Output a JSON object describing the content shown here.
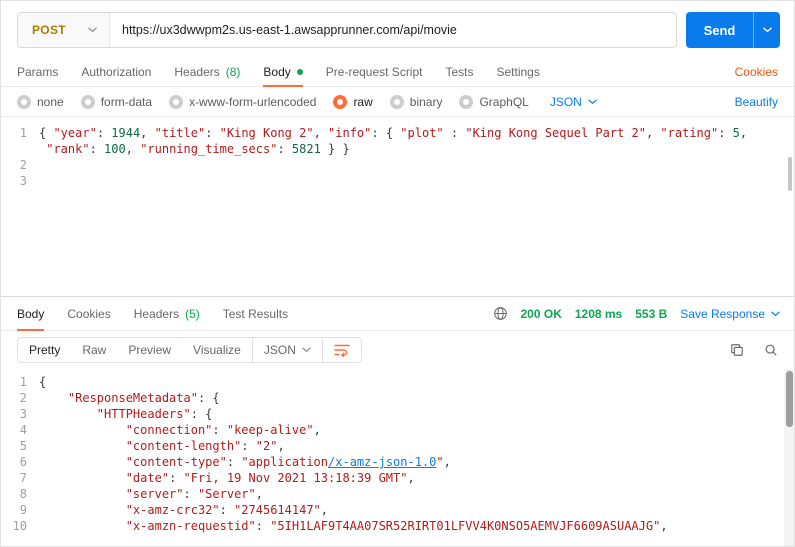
{
  "colors": {
    "accent_orange": "#ff6c37",
    "link_blue": "#097bed",
    "status_green": "#0ca750",
    "method_post_amber": "#ad7a03",
    "cookies_link_orange": "#e8590c",
    "code_string_red": "#b11b1b",
    "code_number_green": "#116644"
  },
  "request": {
    "method": "POST",
    "url": "https://ux3dwwpm2s.us-east-1.awsapprunner.com/api/movie",
    "send_label": "Send",
    "tabs": [
      {
        "label": "Params"
      },
      {
        "label": "Authorization"
      },
      {
        "label": "Headers",
        "count": "(8)"
      },
      {
        "label": "Body"
      },
      {
        "label": "Pre-request Script"
      },
      {
        "label": "Tests"
      },
      {
        "label": "Settings"
      }
    ],
    "cookies_link": "Cookies",
    "body_modes": [
      "none",
      "form-data",
      "x-www-form-urlencoded",
      "raw",
      "binary",
      "GraphQL"
    ],
    "selected_mode": "raw",
    "language": "JSON",
    "beautify_link": "Beautify",
    "code": [
      {
        "num": "1",
        "tokens": [
          {
            "t": "{ ",
            "c": "p"
          },
          {
            "t": "\"year\"",
            "c": "k"
          },
          {
            "t": ": ",
            "c": "p"
          },
          {
            "t": "1944",
            "c": "n"
          },
          {
            "t": ", ",
            "c": "p"
          },
          {
            "t": "\"title\"",
            "c": "k"
          },
          {
            "t": ": ",
            "c": "p"
          },
          {
            "t": "\"King Kong 2\"",
            "c": "s"
          },
          {
            "t": ", ",
            "c": "p"
          },
          {
            "t": "\"info\"",
            "c": "k"
          },
          {
            "t": ": { ",
            "c": "p"
          },
          {
            "t": "\"plot\"",
            "c": "k"
          },
          {
            "t": " : ",
            "c": "p"
          },
          {
            "t": "\"King Kong Sequel Part 2\"",
            "c": "s"
          },
          {
            "t": ", ",
            "c": "p"
          },
          {
            "t": "\"rating\"",
            "c": "k"
          },
          {
            "t": ": ",
            "c": "p"
          },
          {
            "t": "5",
            "c": "n"
          },
          {
            "t": ",",
            "c": "p"
          }
        ]
      },
      {
        "num": "",
        "tokens": [
          {
            "t": " ",
            "c": "p"
          },
          {
            "t": "\"rank\"",
            "c": "k"
          },
          {
            "t": ": ",
            "c": "p"
          },
          {
            "t": "100",
            "c": "n"
          },
          {
            "t": ", ",
            "c": "p"
          },
          {
            "t": "\"running_time_secs\"",
            "c": "k"
          },
          {
            "t": ": ",
            "c": "p"
          },
          {
            "t": "5821",
            "c": "n"
          },
          {
            "t": " } }",
            "c": "p"
          }
        ]
      },
      {
        "num": "2",
        "tokens": []
      },
      {
        "num": "3",
        "tokens": []
      }
    ]
  },
  "response": {
    "tabs": [
      {
        "label": "Body"
      },
      {
        "label": "Cookies"
      },
      {
        "label": "Headers",
        "count": "(5)"
      },
      {
        "label": "Test Results"
      }
    ],
    "status": "200 OK",
    "time": "1208 ms",
    "size": "553 B",
    "save_label": "Save Response",
    "views": [
      "Pretty",
      "Raw",
      "Preview",
      "Visualize"
    ],
    "active_view": "Pretty",
    "language": "JSON",
    "code": [
      {
        "num": "1",
        "tokens": [
          {
            "t": "{",
            "c": "p"
          }
        ]
      },
      {
        "num": "2",
        "tokens": [
          {
            "t": "    ",
            "c": "p"
          },
          {
            "t": "\"ResponseMetadata\"",
            "c": "k"
          },
          {
            "t": ": {",
            "c": "p"
          }
        ]
      },
      {
        "num": "3",
        "tokens": [
          {
            "t": "        ",
            "c": "p"
          },
          {
            "t": "\"HTTPHeaders\"",
            "c": "k"
          },
          {
            "t": ": {",
            "c": "p"
          }
        ]
      },
      {
        "num": "4",
        "tokens": [
          {
            "t": "            ",
            "c": "p"
          },
          {
            "t": "\"connection\"",
            "c": "k"
          },
          {
            "t": ": ",
            "c": "p"
          },
          {
            "t": "\"keep-alive\"",
            "c": "s"
          },
          {
            "t": ",",
            "c": "p"
          }
        ]
      },
      {
        "num": "5",
        "tokens": [
          {
            "t": "            ",
            "c": "p"
          },
          {
            "t": "\"content-length\"",
            "c": "k"
          },
          {
            "t": ": ",
            "c": "p"
          },
          {
            "t": "\"2\"",
            "c": "s"
          },
          {
            "t": ",",
            "c": "p"
          }
        ]
      },
      {
        "num": "6",
        "tokens": [
          {
            "t": "            ",
            "c": "p"
          },
          {
            "t": "\"content-type\"",
            "c": "k"
          },
          {
            "t": ": ",
            "c": "p"
          },
          {
            "t": "\"application",
            "c": "s"
          },
          {
            "t": "/x-amz-json-1.0",
            "c": "l"
          },
          {
            "t": "\"",
            "c": "s"
          },
          {
            "t": ",",
            "c": "p"
          }
        ]
      },
      {
        "num": "7",
        "tokens": [
          {
            "t": "            ",
            "c": "p"
          },
          {
            "t": "\"date\"",
            "c": "k"
          },
          {
            "t": ": ",
            "c": "p"
          },
          {
            "t": "\"Fri, 19 Nov 2021 13:18:39 GMT\"",
            "c": "s"
          },
          {
            "t": ",",
            "c": "p"
          }
        ]
      },
      {
        "num": "8",
        "tokens": [
          {
            "t": "            ",
            "c": "p"
          },
          {
            "t": "\"server\"",
            "c": "k"
          },
          {
            "t": ": ",
            "c": "p"
          },
          {
            "t": "\"Server\"",
            "c": "s"
          },
          {
            "t": ",",
            "c": "p"
          }
        ]
      },
      {
        "num": "9",
        "tokens": [
          {
            "t": "            ",
            "c": "p"
          },
          {
            "t": "\"x-amz-crc32\"",
            "c": "k"
          },
          {
            "t": ": ",
            "c": "p"
          },
          {
            "t": "\"2745614147\"",
            "c": "s"
          },
          {
            "t": ",",
            "c": "p"
          }
        ]
      },
      {
        "num": "10",
        "tokens": [
          {
            "t": "            ",
            "c": "p"
          },
          {
            "t": "\"x-amzn-requestid\"",
            "c": "k"
          },
          {
            "t": ": ",
            "c": "p"
          },
          {
            "t": "\"5IH1LAF9T4AA07SR52RIRT01LFVV4K0NSO5AEMVJF6609ASUAAJG\"",
            "c": "s"
          },
          {
            "t": ",",
            "c": "p"
          }
        ]
      }
    ]
  }
}
